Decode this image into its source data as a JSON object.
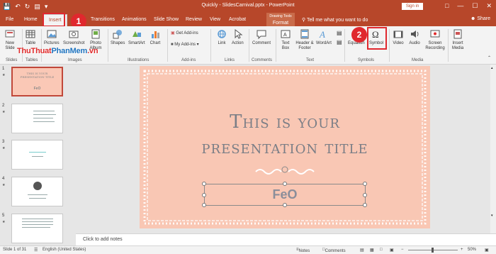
{
  "titlebar": {
    "doc_title": "Quickly - SlidesCarnival.pptx  -  PowerPoint",
    "signin": "Sign in",
    "save_icon": "save-icon",
    "undo_icon": "undo-icon",
    "redo_icon": "redo-icon",
    "present_icon": "present-icon"
  },
  "tabs": {
    "items": [
      "File",
      "Home",
      "Insert",
      "Transitions",
      "Animations",
      "Slide Show",
      "Review",
      "View",
      "Acrobat",
      "Format"
    ],
    "drawing_tools": "Drawing Tools",
    "tell_me": "Tell me what you want to do",
    "share": "Share"
  },
  "callouts": {
    "one": "1",
    "two": "2"
  },
  "ribbon": {
    "new_slide": "New Slide",
    "table": "Table",
    "pictures": "Pictures",
    "screenshot": "Screenshot",
    "photo_album": "Photo Album",
    "shapes": "Shapes",
    "smartart": "SmartArt",
    "chart": "Chart",
    "get_addins": "Get Add-ins",
    "my_addins": "My Add-ins",
    "link": "Link",
    "action": "Action",
    "comment": "Comment",
    "text_box": "Text Box",
    "header_footer": "Header & Footer",
    "wordart": "WordArt",
    "equation": "Equation",
    "symbol": "Symbol",
    "video": "Video",
    "audio": "Audio",
    "screen_recording": "Screen Recording",
    "insert_media": "Insert Media",
    "groups": {
      "slides": "Slides",
      "tables": "Tables",
      "images": "Images",
      "illustrations": "Illustrations",
      "addins": "Add-ins",
      "links": "Links",
      "comments": "Comments",
      "text": "Text",
      "symbols": "Symbols",
      "media": "Media"
    },
    "watermark_red": "ThuThuat",
    "watermark_blue": "PhanMem",
    "watermark_tail": ".vn"
  },
  "thumbnails": {
    "numbers": [
      "1",
      "2",
      "3",
      "4",
      "5"
    ],
    "slide1_title": "THIS IS YOUR PRESENTATION TITLE",
    "slide1_feo": "FeO"
  },
  "slide": {
    "title_line1": "This is your",
    "title_line2": "presentation title",
    "subtitle": "FeO"
  },
  "notes_placeholder": "Click to add notes",
  "statusbar": {
    "slide_of": "Slide 1 of 31",
    "language": "English (United States)",
    "notes": "Notes",
    "comments": "Comments",
    "zoom": "50%"
  },
  "colors": {
    "accent": "#b7472a",
    "slide_bg": "#f9c7b4",
    "callout": "#e0282e"
  }
}
